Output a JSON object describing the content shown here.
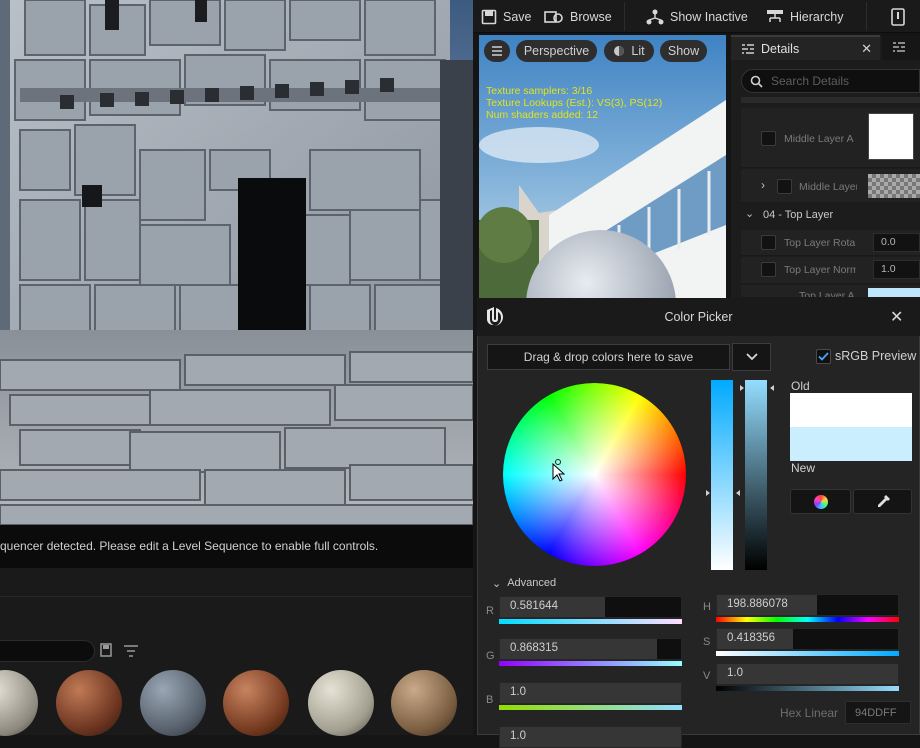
{
  "toolbar": {
    "save": "Save",
    "browse": "Browse",
    "show_inactive": "Show Inactive",
    "hierarchy": "Hierarchy"
  },
  "viewport": {
    "message": "quencer detected. Please edit a Level Sequence to enable full controls."
  },
  "preview": {
    "perspective": "Perspective",
    "lit": "Lit",
    "show": "Show",
    "stats": [
      "Texture samplers: 3/16",
      "Texture Lookups (Est.): VS(3), PS(12)",
      "Num shaders added: 12"
    ]
  },
  "details": {
    "tab": "Details",
    "search_placeholder": "Search Details",
    "rows": {
      "middle_a": "Middle Layer A",
      "middle": "Middle Layer",
      "section": "04 - Top Layer",
      "top_rot": "Top Layer Rota",
      "top_rot_val": "0.0",
      "top_norm": "Top Layer Norm",
      "top_norm_val": "1.0",
      "top_a": "Top Layer A"
    }
  },
  "picker": {
    "title": "Color Picker",
    "drag_hint": "Drag & drop colors here to save",
    "srgb": "sRGB Preview",
    "old": "Old",
    "new": "New",
    "advanced": "Advanced",
    "r_label": "R",
    "r": "0.581644",
    "g_label": "G",
    "g": "0.868315",
    "b_label": "B",
    "b": "1.0",
    "a": "1.0",
    "h_label": "H",
    "h": "198.886078",
    "s_label": "S",
    "s": "0.418356",
    "v_label": "V",
    "v": "1.0",
    "hex_label": "Hex Linear",
    "hex": "94DDFF",
    "colors": {
      "old": "#ffffff",
      "new": "#cbeeff",
      "accent": "#4aa3ff"
    }
  }
}
